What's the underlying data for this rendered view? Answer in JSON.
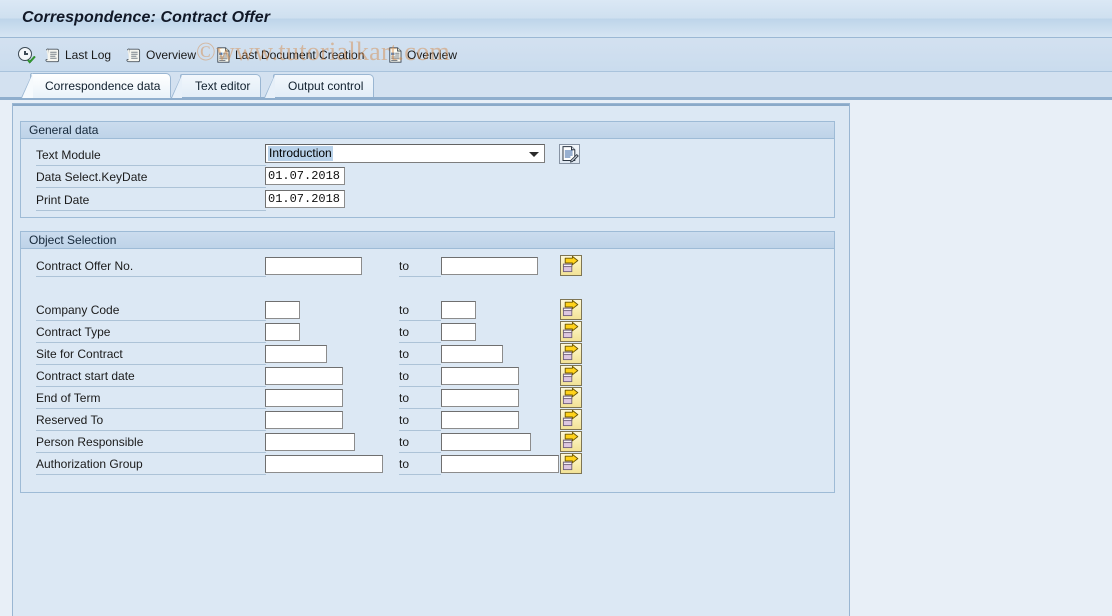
{
  "window": {
    "title": "Correspondence: Contract Offer"
  },
  "watermark": {
    "text": "©www.tutorialkart.com"
  },
  "toolbar": {
    "items": [
      {
        "label": "",
        "icon": "clock-check-icon",
        "name": "execute-check-button"
      },
      {
        "label": "Last Log",
        "icon": "log-scroll-icon",
        "name": "last-log-button"
      },
      {
        "label": "Overview",
        "icon": "log-scroll-icon",
        "name": "overview-button"
      },
      {
        "label": "Last Document Creation",
        "icon": "document-icon",
        "name": "last-document-creation-button"
      },
      {
        "label": "Overview",
        "icon": "document-icon",
        "name": "document-overview-button"
      }
    ]
  },
  "tabs": [
    {
      "label": "Correspondence data",
      "selected": true
    },
    {
      "label": "Text editor",
      "selected": false
    },
    {
      "label": "Output control",
      "selected": false
    }
  ],
  "general_data": {
    "header": "General data",
    "text_module": {
      "label": "Text Module",
      "value": "Introduction",
      "options": [
        "Introduction"
      ],
      "edit_icon": "document-edit-icon"
    },
    "data_select_keydate": {
      "label": "Data Select.KeyDate",
      "value": "01.07.2018",
      "placeholder": ""
    },
    "print_date": {
      "label": "Print Date",
      "value": "01.07.2018",
      "placeholder": ""
    }
  },
  "object_selection": {
    "header": "Object Selection",
    "to_label": "to",
    "select_icon": "multiple-selection-arrow-icon",
    "rows": [
      {
        "label": "Contract Offer No.",
        "from": "",
        "to": "",
        "from_width": 97,
        "to_width": 97,
        "gap_after": true
      },
      {
        "label": "Company Code",
        "from": "",
        "to": "",
        "from_width": 35,
        "to_width": 35
      },
      {
        "label": "Contract Type",
        "from": "",
        "to": "",
        "from_width": 35,
        "to_width": 35
      },
      {
        "label": "Site for Contract",
        "from": "",
        "to": "",
        "from_width": 62,
        "to_width": 62
      },
      {
        "label": "Contract start date",
        "from": "",
        "to": "",
        "from_width": 78,
        "to_width": 78
      },
      {
        "label": "End of Term",
        "from": "",
        "to": "",
        "from_width": 78,
        "to_width": 78
      },
      {
        "label": "Reserved To",
        "from": "",
        "to": "",
        "from_width": 78,
        "to_width": 78
      },
      {
        "label": "Person Responsible",
        "from": "",
        "to": "",
        "from_width": 90,
        "to_width": 90
      },
      {
        "label": "Authorization Group",
        "from": "",
        "to": "",
        "from_width": 118,
        "to_width": 118
      }
    ]
  },
  "colors": {
    "window_background": "#e8eff7",
    "panel_background": "#dce8f4",
    "titlebar_gradient_top": "#dbe8f5",
    "accent_border": "#9ab6d2",
    "select_button": "#f8edb0",
    "watermark": "#d6863e"
  }
}
